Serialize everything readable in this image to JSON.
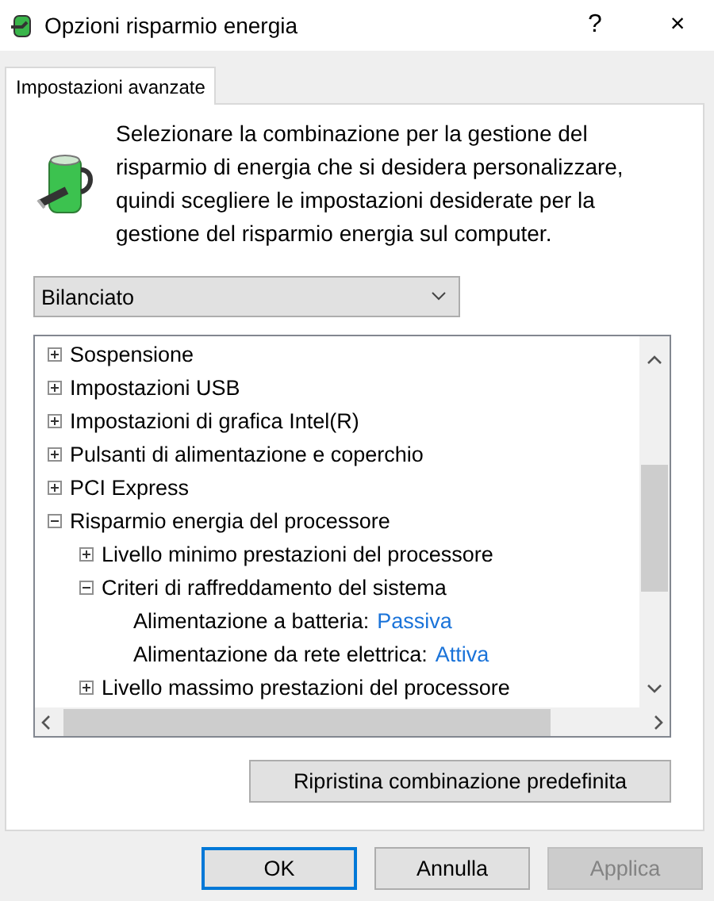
{
  "window": {
    "title": "Opzioni risparmio energia",
    "help": "?",
    "close": "×"
  },
  "tabs": [
    {
      "label": "Impostazioni avanzate",
      "selected": true
    }
  ],
  "description": "Selezionare la combinazione per la gestione del risparmio di energia che si desidera personalizzare, quindi scegliere le impostazioni desiderate per la gestione del risparmio energia sul computer.",
  "plan_select": {
    "value": "Bilanciato"
  },
  "tree": [
    {
      "kind": "group",
      "label": "Sospensione",
      "expanded": false
    },
    {
      "kind": "group",
      "label": "Impostazioni USB",
      "expanded": false
    },
    {
      "kind": "group",
      "label": "Impostazioni di grafica Intel(R)",
      "expanded": false
    },
    {
      "kind": "group",
      "label": "Pulsanti di alimentazione e coperchio",
      "expanded": false
    },
    {
      "kind": "group",
      "label": "PCI Express",
      "expanded": false
    },
    {
      "kind": "group",
      "label": "Risparmio energia del processore",
      "expanded": true,
      "children": [
        {
          "kind": "group",
          "label": "Livello minimo prestazioni del processore",
          "expanded": false
        },
        {
          "kind": "group",
          "label": "Criteri di raffreddamento del sistema",
          "expanded": true,
          "children": [
            {
              "kind": "setting",
              "label": "Alimentazione a batteria:",
              "value": "Passiva"
            },
            {
              "kind": "setting",
              "label": "Alimentazione da rete elettrica:",
              "value": "Attiva"
            }
          ]
        },
        {
          "kind": "group",
          "label": "Livello massimo prestazioni del processore",
          "expanded": false
        }
      ]
    }
  ],
  "restore_button": "Ripristina combinazione predefinita",
  "buttons": [
    {
      "label": "OK",
      "default": true,
      "disabled": false
    },
    {
      "label": "Annulla",
      "default": false,
      "disabled": false
    },
    {
      "label": "Applica",
      "default": false,
      "disabled": true
    }
  ]
}
